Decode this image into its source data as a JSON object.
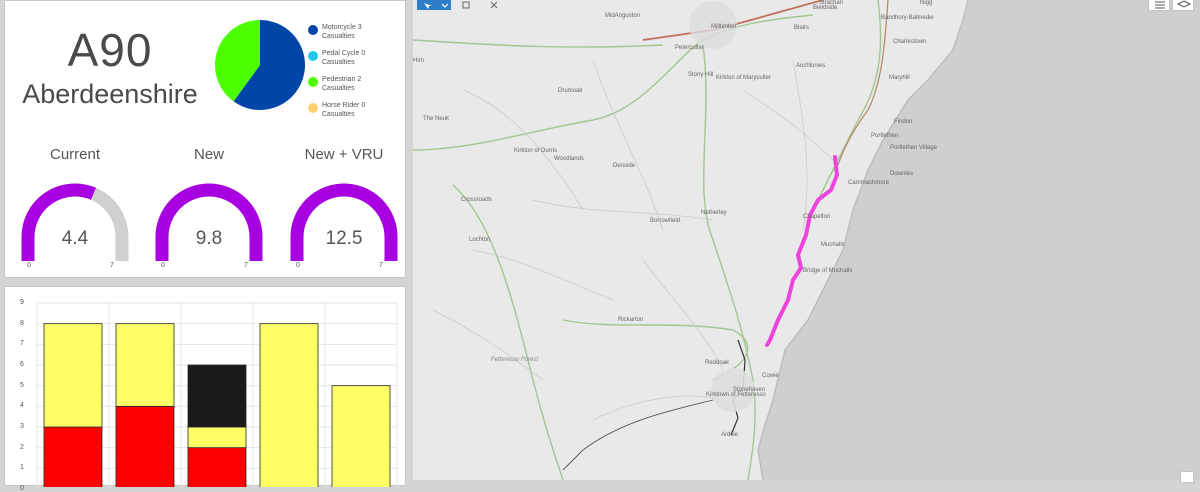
{
  "summary": {
    "route": "A90",
    "region": "Aberdeenshire",
    "legend": [
      {
        "label": "Motorcycle",
        "count": "3",
        "unit": "Casualties",
        "color": "#0046a8"
      },
      {
        "label": "Pedal Cycle",
        "count": "0",
        "unit": "Casualties",
        "color": "#1ec8f0"
      },
      {
        "label": "Pedestrian",
        "count": "2",
        "unit": "Casualties",
        "color": "#4cff00"
      },
      {
        "label": "Horse Rider",
        "count": "0",
        "unit": "Casualties",
        "color": "#ffcf70"
      }
    ]
  },
  "gauges": [
    {
      "label": "Current",
      "value": "4.4",
      "value_num": 4.4,
      "min": "0",
      "max": "7",
      "max_num": 7
    },
    {
      "label": "New",
      "value": "9.8",
      "value_num": 9.8,
      "min": "0",
      "max": "7",
      "max_num": 7
    },
    {
      "label": "New + VRU",
      "value": "12.5",
      "value_num": 12.5,
      "min": "0",
      "max": "7",
      "max_num": 7
    }
  ],
  "colors": {
    "gauge_fill": "#a800e0",
    "gauge_track": "#d0d0d0",
    "bar_red": "#ff0000",
    "bar_yellow": "#ffff66",
    "bar_black": "#1a1a1a",
    "route_highlight": "#ee44dd"
  },
  "chart_data": [
    {
      "type": "pie",
      "slices": [
        {
          "label": "Motorcycle",
          "value": 3,
          "color": "#0046a8"
        },
        {
          "label": "Pedal Cycle",
          "value": 0,
          "color": "#1ec8f0"
        },
        {
          "label": "Pedestrian",
          "value": 2,
          "color": "#4cff00"
        },
        {
          "label": "Horse Rider",
          "value": 0,
          "color": "#ffcf70"
        }
      ]
    },
    {
      "type": "bar",
      "stacked": true,
      "ylim": [
        0,
        9
      ],
      "yticks": [
        "0",
        "1",
        "2",
        "3",
        "4",
        "5",
        "6",
        "7",
        "8",
        "9"
      ],
      "grid": true,
      "columns": 5,
      "series": [
        {
          "color": "#ff0000",
          "values": [
            3,
            4,
            2,
            0,
            0
          ]
        },
        {
          "color": "#ffff66",
          "values": [
            5,
            4,
            1,
            8,
            5
          ]
        },
        {
          "color": "#1a1a1a",
          "values": [
            0,
            0,
            3,
            0,
            0
          ]
        }
      ]
    }
  ],
  "map": {
    "labels": [
      {
        "text": "MidAnguston"
      },
      {
        "text": "Milltimber"
      },
      {
        "text": "Peterculter"
      },
      {
        "text": "Blairs"
      },
      {
        "text": "Bieldside"
      },
      {
        "text": "Bandhory-Balmedie"
      },
      {
        "text": "Charlestown"
      },
      {
        "text": "Hirn"
      },
      {
        "text": "Stony Hill"
      },
      {
        "text": "Kirkton of Maryculter"
      },
      {
        "text": "Auchlunies"
      },
      {
        "text": "Maryhill"
      },
      {
        "text": "Drumoak"
      },
      {
        "text": "The Neuk"
      },
      {
        "text": "Findon"
      },
      {
        "text": "Portlethen"
      },
      {
        "text": "Portlethen Village"
      },
      {
        "text": "Kirkton of Durris"
      },
      {
        "text": "Woodlands"
      },
      {
        "text": "Denside"
      },
      {
        "text": "Downies"
      },
      {
        "text": "Cammachmore"
      },
      {
        "text": "Crossroads"
      },
      {
        "text": "Netherley"
      },
      {
        "text": "Chapelton"
      },
      {
        "text": "Borrowfield"
      },
      {
        "text": "Lochton"
      },
      {
        "text": "Muchalls"
      },
      {
        "text": "Bridge of Muchalls"
      },
      {
        "text": "Rickarton"
      },
      {
        "text": "Fetteresso Forest"
      },
      {
        "text": "Reddoak"
      },
      {
        "text": "Cowie"
      },
      {
        "text": "Stonehaven"
      },
      {
        "text": "Kirktown of Fetteresso"
      },
      {
        "text": "Ardsie"
      },
      {
        "text": "Strachan"
      },
      {
        "text": "Nigg"
      }
    ]
  }
}
